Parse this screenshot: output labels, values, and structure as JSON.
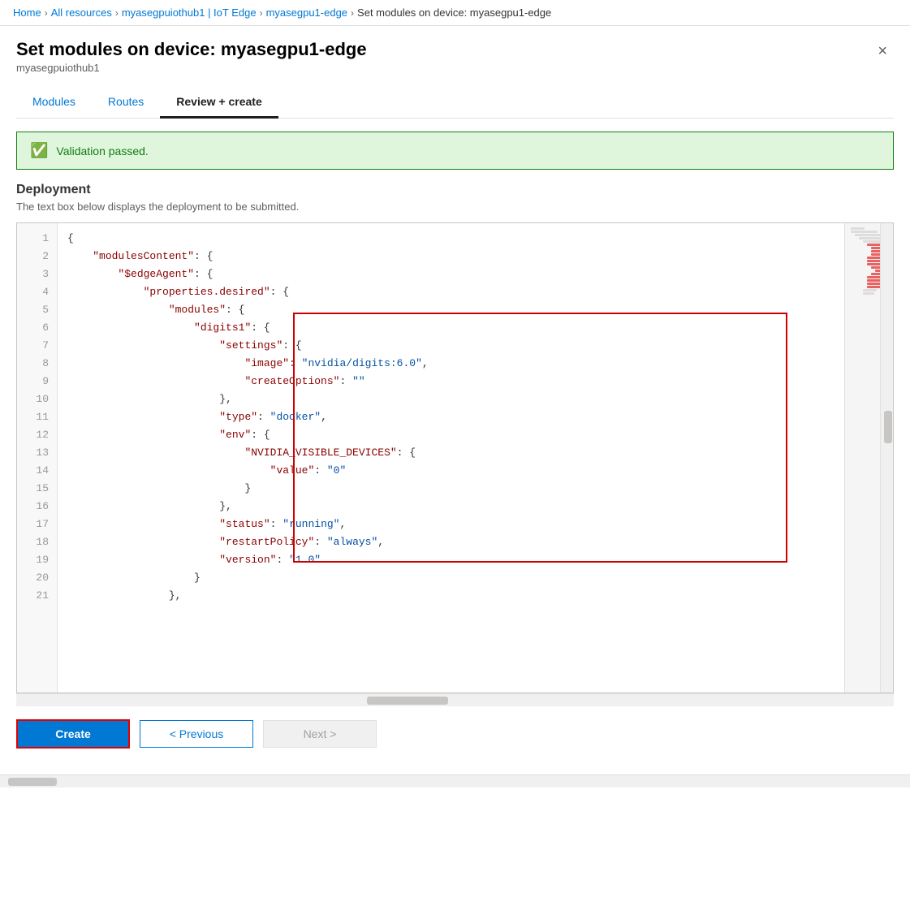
{
  "breadcrumb": {
    "items": [
      {
        "label": "Home",
        "link": true
      },
      {
        "label": "All resources",
        "link": true
      },
      {
        "label": "myasegpuiothub1 | IoT Edge",
        "link": true
      },
      {
        "label": "myasegpu1-edge",
        "link": true
      },
      {
        "label": "Set modules on device: myasegpu1-edge",
        "link": false
      }
    ]
  },
  "header": {
    "title": "Set modules on device: myasegpu1-edge",
    "subtitle": "myasegpuiothub1",
    "close_label": "×"
  },
  "tabs": [
    {
      "label": "Modules",
      "active": false
    },
    {
      "label": "Routes",
      "active": false
    },
    {
      "label": "Review + create",
      "active": true
    }
  ],
  "validation": {
    "text": "Validation passed."
  },
  "deployment": {
    "title": "Deployment",
    "description": "The text box below displays the deployment to be submitted."
  },
  "code_lines": [
    {
      "num": 1,
      "content": "{",
      "highlighted": false
    },
    {
      "num": 2,
      "content": "    \"modulesContent\": {",
      "highlighted": false
    },
    {
      "num": 3,
      "content": "        \"$edgeAgent\": {",
      "highlighted": false
    },
    {
      "num": 4,
      "content": "            \"properties.desired\": {",
      "highlighted": false
    },
    {
      "num": 5,
      "content": "                \"modules\": {",
      "highlighted": false
    },
    {
      "num": 6,
      "content": "                    \"digits1\": {",
      "highlighted": true
    },
    {
      "num": 7,
      "content": "                        \"settings\": {",
      "highlighted": true
    },
    {
      "num": 8,
      "content": "                            \"image\": \"nvidia/digits:6.0\",",
      "highlighted": true
    },
    {
      "num": 9,
      "content": "                            \"createOptions\": \"\"",
      "highlighted": true
    },
    {
      "num": 10,
      "content": "                        },",
      "highlighted": true
    },
    {
      "num": 11,
      "content": "                        \"type\": \"docker\",",
      "highlighted": true
    },
    {
      "num": 12,
      "content": "                        \"env\": {",
      "highlighted": true
    },
    {
      "num": 13,
      "content": "                            \"NVIDIA_VISIBLE_DEVICES\": {",
      "highlighted": true
    },
    {
      "num": 14,
      "content": "                                \"value\": \"0\"",
      "highlighted": true
    },
    {
      "num": 15,
      "content": "                            }",
      "highlighted": true
    },
    {
      "num": 16,
      "content": "                        },",
      "highlighted": true
    },
    {
      "num": 17,
      "content": "                        \"status\": \"running\",",
      "highlighted": true
    },
    {
      "num": 18,
      "content": "                        \"restartPolicy\": \"always\",",
      "highlighted": true
    },
    {
      "num": 19,
      "content": "                        \"version\": \"1.0\"",
      "highlighted": true
    },
    {
      "num": 20,
      "content": "                    }",
      "highlighted": false
    },
    {
      "num": 21,
      "content": "                },",
      "highlighted": false
    }
  ],
  "buttons": {
    "create": "Create",
    "previous": "< Previous",
    "next": "Next >"
  }
}
